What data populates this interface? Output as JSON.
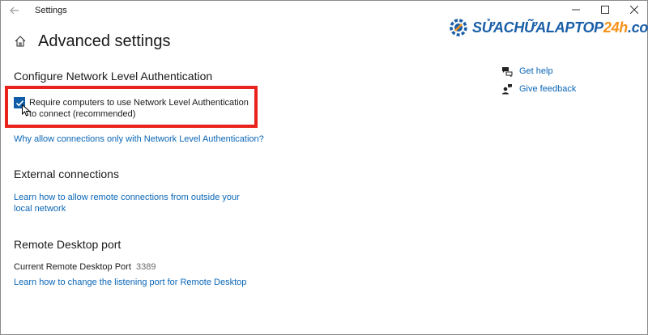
{
  "window": {
    "title": "Settings"
  },
  "logo": {
    "text_main": "SỬACHỮALAPTOP",
    "text_accent": "24h",
    "text_suffix": ".com",
    "brand_color": "#1a5fa8",
    "accent_color": "#f7941d"
  },
  "header": {
    "title": "Advanced settings"
  },
  "nla": {
    "title": "Configure Network Level Authentication",
    "checkbox_label": "Require computers to use Network Level Authentication to connect (recommended)",
    "checked": true,
    "link": "Why allow connections only with Network Level Authentication?"
  },
  "external": {
    "title": "External connections",
    "link": "Learn how to allow remote connections from outside your local network"
  },
  "port": {
    "title": "Remote Desktop port",
    "label": "Current Remote Desktop Port",
    "value": "3389",
    "link": "Learn how to change the listening port for Remote Desktop"
  },
  "side": {
    "help": "Get help",
    "feedback": "Give feedback"
  },
  "colors": {
    "link": "#0a66b7",
    "highlight": "#e8231c",
    "checkbox": "#0f5ca8"
  },
  "icons": [
    "back-arrow-icon",
    "home-icon",
    "minimize-icon",
    "maximize-icon",
    "close-icon",
    "help-chat-icon",
    "feedback-person-icon",
    "checkmark-icon",
    "cursor-icon",
    "gear-logo-icon"
  ]
}
